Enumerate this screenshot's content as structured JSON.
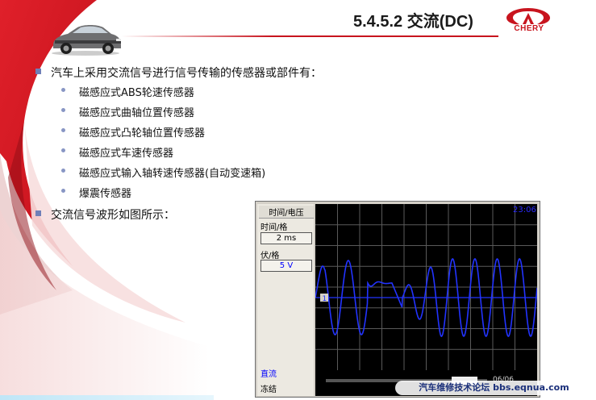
{
  "slide": {
    "title": "5.4.5.2 交流(DC)",
    "brand": "CHERY",
    "accent_color": "#c8141e",
    "icons": [
      "car-photo",
      "chery-logo"
    ]
  },
  "content": {
    "intro": "汽车上采用交流信号进行信号传输的传感器或部件有：",
    "items": [
      "磁感应式ABS轮速传感器",
      "磁感应式曲轴位置传感器",
      "磁感应式凸轮轴位置传感器",
      "磁感应式车速传感器",
      "磁感应式输入轴转速传感器(自动变速箱)",
      "爆震传感器"
    ],
    "waveform_intro": "交流信号波形如图所示："
  },
  "scope": {
    "header": "时间/电压",
    "time_label": "时间/格",
    "time_value": "2 ms",
    "volt_label": "伏/格",
    "volt_value": "5 V",
    "mode": "直流",
    "freeze": "冻结",
    "timestamp": "23:06",
    "page": "06/06",
    "channel_marker": "1",
    "trace_color": "#2233ff"
  },
  "watermark": "汽车维修技术论坛 bbs.eqnua.com"
}
